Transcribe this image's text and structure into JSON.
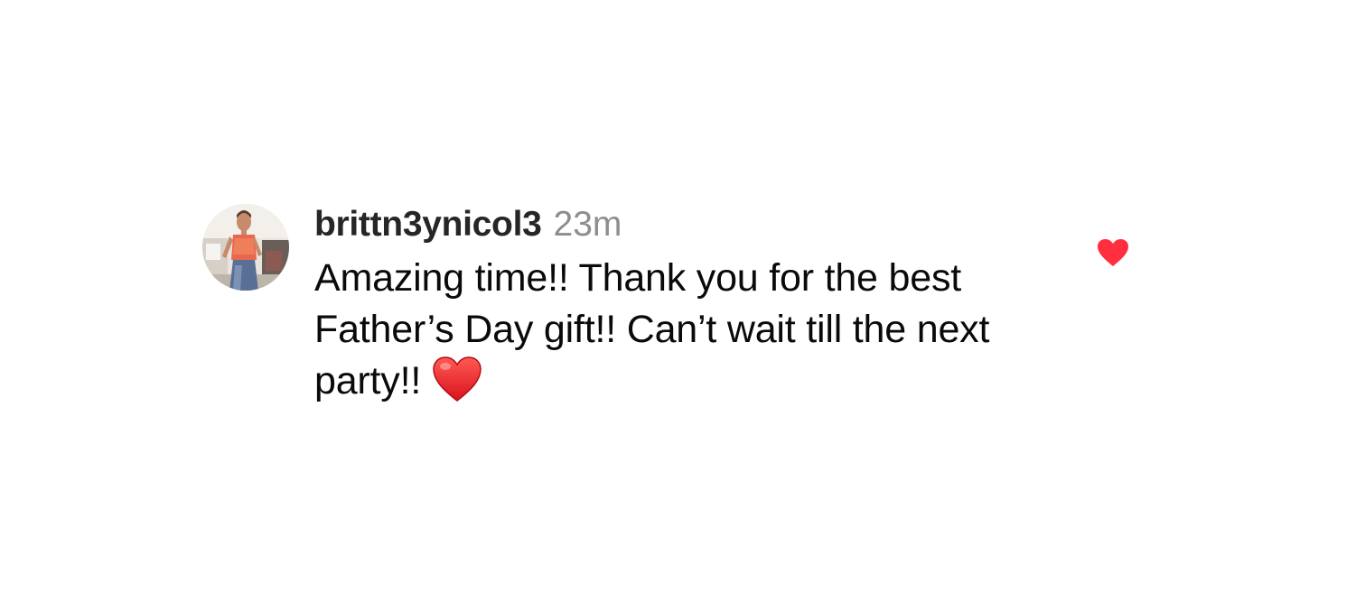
{
  "comment": {
    "username": "brittn3ynicol3",
    "timestamp": "23m",
    "text": "Amazing time!! Thank you for the best Father’s Day gift!! Can’t wait till the next party!!",
    "text_emoji": "red-heart-emoji",
    "liked": true,
    "like_icon": "heart-filled-icon",
    "like_color": "#ff2f40",
    "avatar_icon": "profile-photo"
  }
}
